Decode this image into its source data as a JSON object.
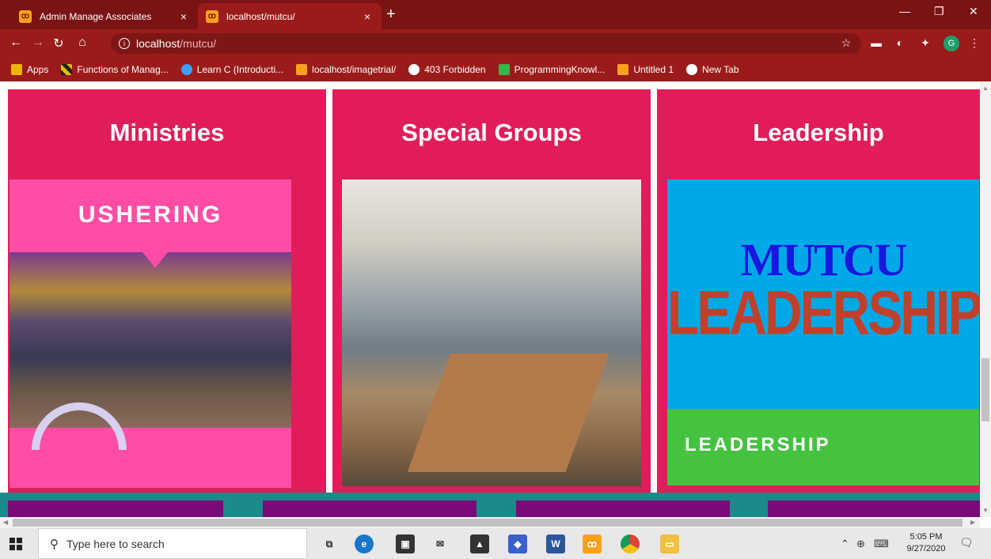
{
  "browser": {
    "tabs": [
      {
        "title": "Admin Manage Associates",
        "active": false
      },
      {
        "title": "localhost/mutcu/",
        "active": true
      }
    ],
    "new_tab_glyph": "+",
    "close_glyph": "×",
    "address": {
      "host": "localhost",
      "path": "/mutcu/"
    },
    "bookmarks": [
      {
        "label": "Apps",
        "icon": "apps-grid-icon",
        "color": "#f0b400"
      },
      {
        "label": "Functions of Manag...",
        "icon": "stripe-icon",
        "color": "#e0c000"
      },
      {
        "label": "Learn C (Introducti...",
        "icon": "learn-c-icon",
        "color": "#3aa0ff"
      },
      {
        "label": "localhost/imagetrial/",
        "icon": "xampp-icon",
        "color": "#f9a11b"
      },
      {
        "label": "403 Forbidden",
        "icon": "globe-icon",
        "color": "#ffffff"
      },
      {
        "label": "ProgrammingKnowl...",
        "icon": "programming-icon",
        "color": "#3ab54a"
      },
      {
        "label": "Untitled 1",
        "icon": "xampp-icon",
        "color": "#f9a11b"
      },
      {
        "label": "New Tab",
        "icon": "globe-icon",
        "color": "#ffffff"
      }
    ],
    "profile_initial": "G"
  },
  "page": {
    "cards": [
      {
        "heading": "Ministries"
      },
      {
        "heading": "Special Groups"
      },
      {
        "heading": "Leadership"
      }
    ],
    "ushering_title": "USHERING",
    "leader_top": "MUTCU",
    "leader_big": "LEADERSHIP",
    "leader_bottom": "LEADERSHIP",
    "colors": {
      "card": "#e01d5a",
      "teal": "#1a8a8a",
      "purple": "#7a0a7a",
      "sky": "#00a8e8",
      "green": "#45c23f"
    }
  },
  "taskbar": {
    "search_placeholder": "Type here to search",
    "time": "5:05 PM",
    "date": "9/27/2020",
    "apps": [
      "task-view-icon",
      "edge-icon",
      "store-icon",
      "mail-icon",
      "photos-icon",
      "blue-app-icon",
      "word-icon",
      "xampp-icon",
      "chrome-icon",
      "file-explorer-icon"
    ]
  }
}
